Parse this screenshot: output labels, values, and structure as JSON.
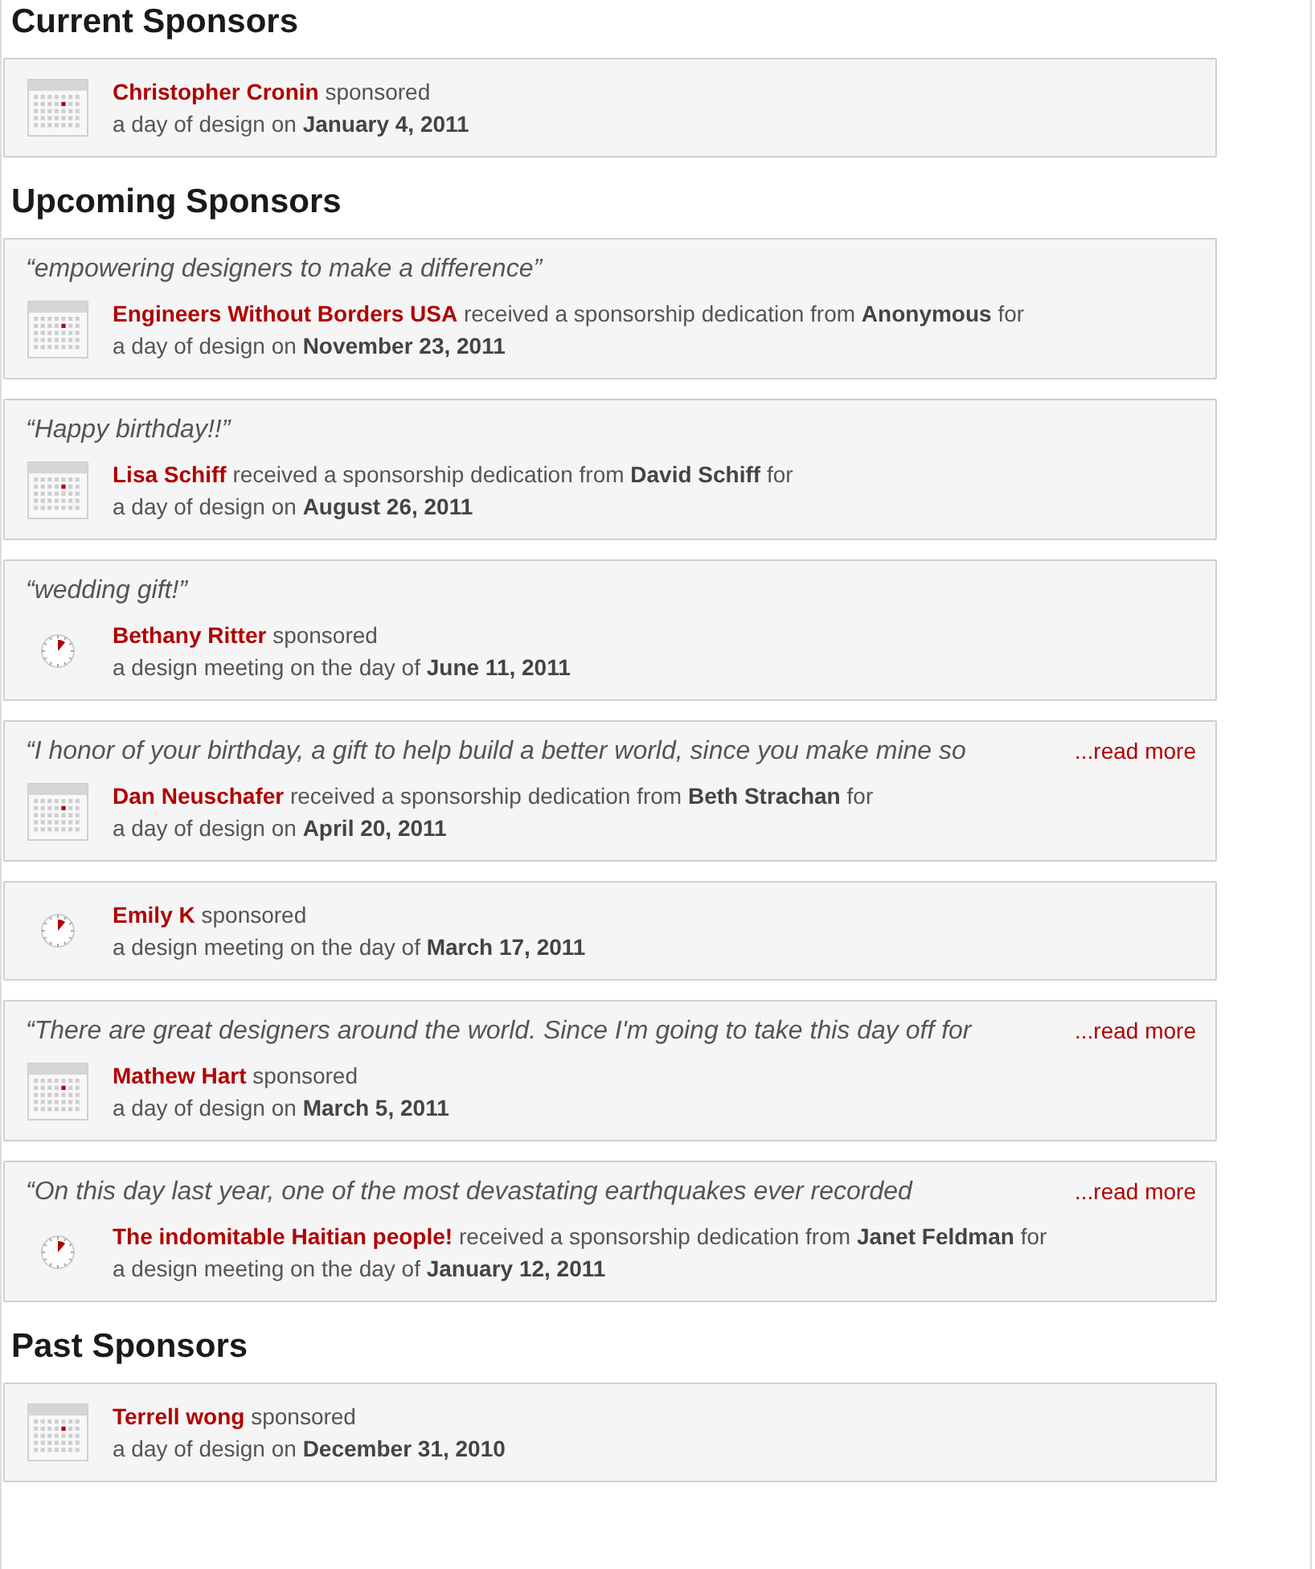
{
  "sections": [
    {
      "title": "Current Sponsors",
      "entries": [
        {
          "kind": "calendar",
          "recipient": "Christopher Cronin",
          "action": "sponsored",
          "detail": "a day of design on **January 4, 2011**"
        }
      ]
    },
    {
      "title": "Upcoming Sponsors",
      "entries": [
        {
          "kind": "calendar",
          "quote": "“empowering designers to make a difference”",
          "recipient": "Engineers Without Borders USA",
          "action": "received a sponsorship dedication from **Anonymous** for",
          "detail": "a day of design on **November 23, 2011**"
        },
        {
          "kind": "calendar",
          "quote": "“Happy birthday!!”",
          "recipient": "Lisa Schiff",
          "action": "received a sponsorship dedication from **David Schiff** for",
          "detail": "a day of design on **August 26, 2011**"
        },
        {
          "kind": "clock",
          "quote": "“wedding gift!”",
          "recipient": "Bethany Ritter",
          "action": "sponsored",
          "detail": "a design meeting on the day of **June 11, 2011**"
        },
        {
          "kind": "calendar",
          "quote": "“I honor of your birthday, a gift to help build a better world, since you make mine so",
          "read_more": "...read more",
          "recipient": "Dan Neuschafer",
          "action": "received a sponsorship dedication from **Beth Strachan** for",
          "detail": "a day of design on **April 20, 2011**"
        },
        {
          "kind": "clock",
          "recipient": "Emily K",
          "action": "sponsored",
          "detail": "a design meeting on the day of **March 17, 2011**"
        },
        {
          "kind": "calendar",
          "quote": "“There are great designers around the world. Since I'm going to take this day off for",
          "read_more": "...read more",
          "recipient": "Mathew Hart",
          "action": "sponsored",
          "detail": "a day of design on **March 5, 2011**"
        },
        {
          "kind": "clock",
          "quote": "“On this day last year, one of the most devastating earthquakes ever recorded",
          "read_more": "...read more",
          "recipient": "The indomitable Haitian people!",
          "action": "received a sponsorship dedication from **Janet Feldman** for",
          "detail": "a design meeting on the day of **January 12, 2011**"
        }
      ]
    },
    {
      "title": "Past Sponsors",
      "entries": [
        {
          "kind": "calendar",
          "recipient": "Terrell wong",
          "action": "sponsored",
          "detail": "a day of design on **December 31, 2010**"
        }
      ]
    }
  ]
}
